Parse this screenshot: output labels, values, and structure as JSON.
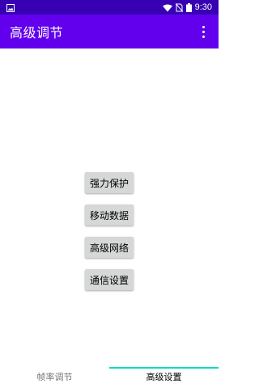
{
  "status_bar": {
    "time": "9:30",
    "icons": [
      "image-icon",
      "wifi-icon",
      "no-sim-icon",
      "battery-icon"
    ]
  },
  "app_bar": {
    "title": "高级调节",
    "menu_icon": "more-vert-icon"
  },
  "buttons": [
    {
      "label": "强力保护"
    },
    {
      "label": "移动数据"
    },
    {
      "label": "高级网络"
    },
    {
      "label": "通信设置"
    }
  ],
  "bottom_nav": {
    "tabs": [
      {
        "label": "帧率调节",
        "active": false
      },
      {
        "label": "高级设置",
        "active": true
      }
    ]
  },
  "colors": {
    "status_bar": "#3700b3",
    "app_bar": "#6200ee",
    "button_bg": "#d6d7d7",
    "active_indicator": "#03dac5"
  }
}
